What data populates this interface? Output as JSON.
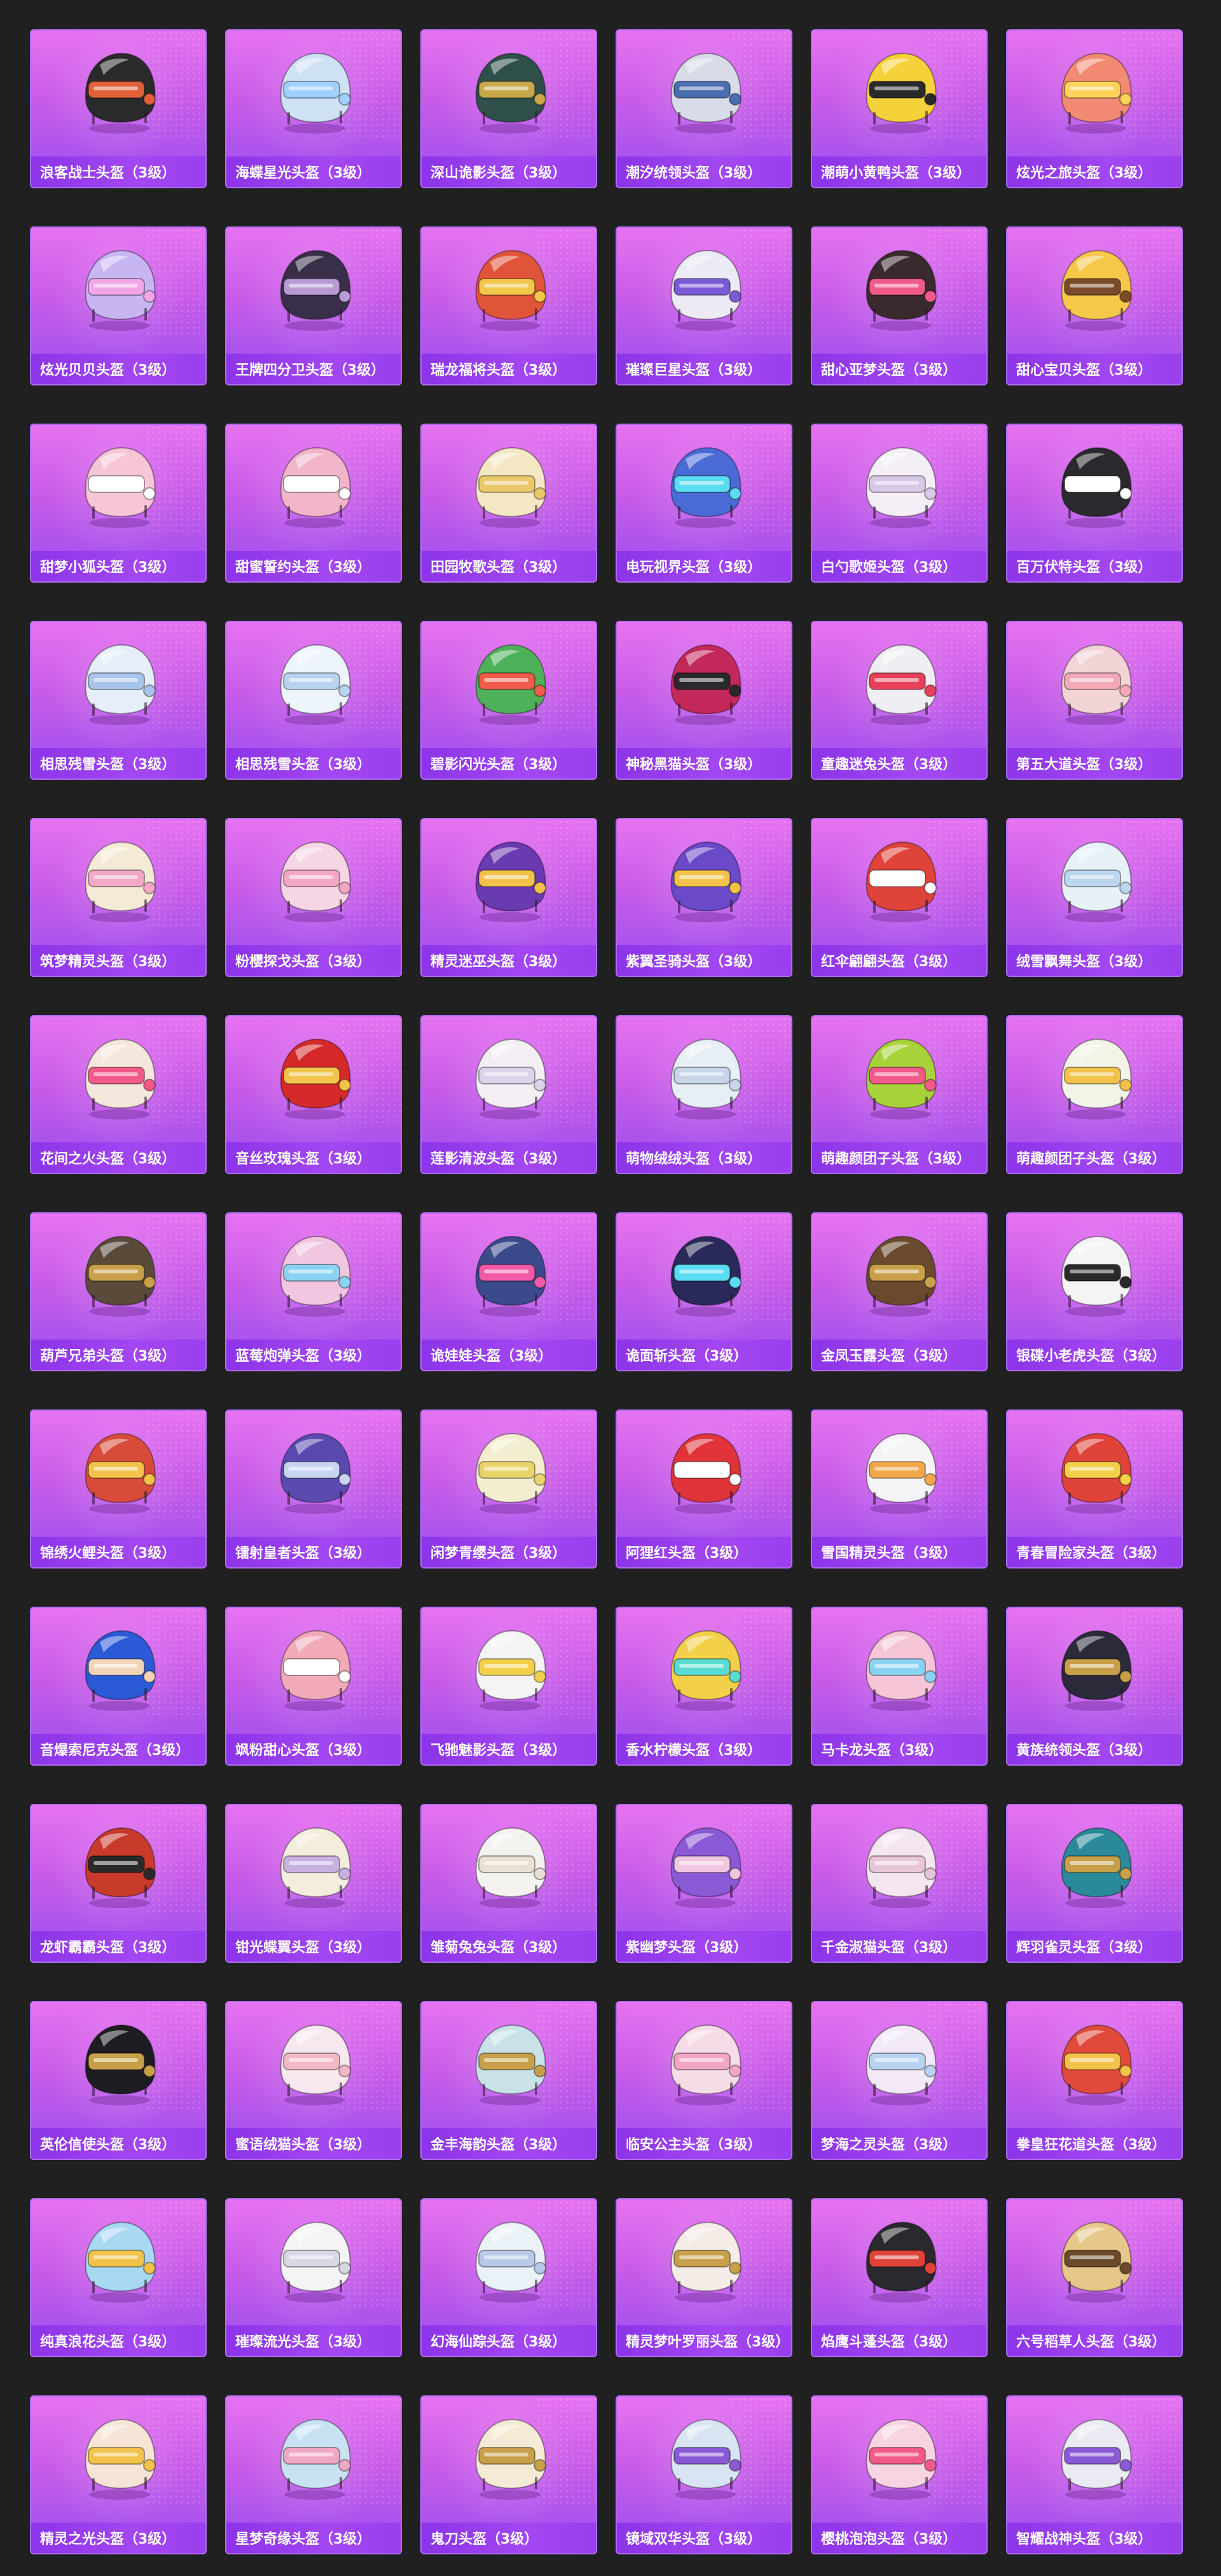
{
  "items": [
    {
      "name": "浪客战士头盔（3级）",
      "icon": "helmet-icon",
      "color": "#2a2a2a",
      "accent": "#e0603a"
    },
    {
      "name": "海蝶星光头盔（3级）",
      "icon": "helmet-icon",
      "color": "#cfe2f5",
      "accent": "#9fd0ff"
    },
    {
      "name": "深山诡影头盔（3级）",
      "icon": "helmet-icon",
      "color": "#2f4f4a",
      "accent": "#c8a84a"
    },
    {
      "name": "潮汐统领头盔（3级）",
      "icon": "helmet-icon",
      "color": "#d8dce8",
      "accent": "#4a6fb0"
    },
    {
      "name": "潮萌小黄鸭头盔（3级）",
      "icon": "helmet-icon",
      "color": "#f6d23a",
      "accent": "#2a2a2a"
    },
    {
      "name": "炫光之旅头盔（3级）",
      "icon": "helmet-icon",
      "color": "#f28a74",
      "accent": "#ffd35a"
    },
    {
      "name": "炫光贝贝头盔（3级）",
      "icon": "helmet-icon",
      "color": "#c8b6f2",
      "accent": "#f2a6e8"
    },
    {
      "name": "王牌四分卫头盔（3级）",
      "icon": "helmet-icon",
      "color": "#3a2f4a",
      "accent": "#b79ad6"
    },
    {
      "name": "瑞龙福将头盔（3级）",
      "icon": "helmet-icon",
      "color": "#e0553a",
      "accent": "#f2c74a"
    },
    {
      "name": "璀璨巨星头盔（3级）",
      "icon": "helmet-icon",
      "color": "#eceaf4",
      "accent": "#7a5ad6"
    },
    {
      "name": "甜心亚梦头盔（3级）",
      "icon": "helmet-icon",
      "color": "#3a2a2e",
      "accent": "#f25a8a"
    },
    {
      "name": "甜心宝贝头盔（3级）",
      "icon": "helmet-icon",
      "color": "#f6c84a",
      "accent": "#7a4a2a"
    },
    {
      "name": "甜梦小狐头盔（3级）",
      "icon": "helmet-icon",
      "color": "#f6c6d6",
      "accent": "#ffffff"
    },
    {
      "name": "甜蜜誓约头盔（3级）",
      "icon": "helmet-icon",
      "color": "#f2b4c8",
      "accent": "#ffffff"
    },
    {
      "name": "田园牧歌头盔（3级）",
      "icon": "helmet-icon",
      "color": "#f3e7c4",
      "accent": "#e8c86a"
    },
    {
      "name": "电玩视界头盔（3级）",
      "icon": "helmet-icon",
      "color": "#4a6ad6",
      "accent": "#5adcf2"
    },
    {
      "name": "白勺歌姬头盔（3级）",
      "icon": "helmet-icon",
      "color": "#f4eef6",
      "accent": "#d8c8e8"
    },
    {
      "name": "百万伏特头盔（3级）",
      "icon": "helmet-icon",
      "color": "#2a2a2e",
      "accent": "#ffffff"
    },
    {
      "name": "相思残雪头盔（3级）",
      "icon": "helmet-icon",
      "color": "#e6eef8",
      "accent": "#a8c4ea"
    },
    {
      "name": "相思残雪头盔（3级）",
      "icon": "helmet-icon",
      "color": "#eef4fb",
      "accent": "#b8d2f2"
    },
    {
      "name": "碧影闪光头盔（3级）",
      "icon": "helmet-icon",
      "color": "#4fb05a",
      "accent": "#f25a4a"
    },
    {
      "name": "神秘黑猫头盔（3级）",
      "icon": "helmet-icon",
      "color": "#c2285a",
      "accent": "#2a2a2e"
    },
    {
      "name": "童趣迷兔头盔（3级）",
      "icon": "helmet-icon",
      "color": "#f0eef2",
      "accent": "#e8405a"
    },
    {
      "name": "第五大道头盔（3级）",
      "icon": "helmet-icon",
      "color": "#f2d4d6",
      "accent": "#f2a8b8"
    },
    {
      "name": "筑梦精灵头盔（3级）",
      "icon": "helmet-icon",
      "color": "#f4ead6",
      "accent": "#f2a8c6"
    },
    {
      "name": "粉樱探戈头盔（3级）",
      "icon": "helmet-icon",
      "color": "#f6d6e4",
      "accent": "#f2a6c8"
    },
    {
      "name": "精灵迷巫头盔（3级）",
      "icon": "helmet-icon",
      "color": "#6a3ab0",
      "accent": "#f2c24a"
    },
    {
      "name": "紫翼圣骑头盔（3级）",
      "icon": "helmet-icon",
      "color": "#6a4ac8",
      "accent": "#f2c24a"
    },
    {
      "name": "红伞翩翩头盔（3级）",
      "icon": "helmet-icon",
      "color": "#e0433a",
      "accent": "#ffffff"
    },
    {
      "name": "绒雪飘舞头盔（3级）",
      "icon": "helmet-icon",
      "color": "#e8f0f8",
      "accent": "#bcd6ee"
    },
    {
      "name": "花间之火头盔（3级）",
      "icon": "helmet-icon",
      "color": "#f4e8dc",
      "accent": "#f25a8a"
    },
    {
      "name": "音丝玫瑰头盔（3级）",
      "icon": "helmet-icon",
      "color": "#d62a2a",
      "accent": "#f2c24a"
    },
    {
      "name": "莲影清波头盔（3级）",
      "icon": "helmet-icon",
      "color": "#f2eef4",
      "accent": "#dcd2ea"
    },
    {
      "name": "萌物绒绒头盔（3级）",
      "icon": "helmet-icon",
      "color": "#e8eef6",
      "accent": "#c8d4ea"
    },
    {
      "name": "萌趣颜团子头盔（3级）",
      "icon": "helmet-icon",
      "color": "#a8d23a",
      "accent": "#f25a8a"
    },
    {
      "name": "萌趣颜团子头盔（3级）",
      "icon": "helmet-icon",
      "color": "#f2f4e8",
      "accent": "#f2c24a"
    },
    {
      "name": "葫芦兄弟头盔（3级）",
      "icon": "helmet-icon",
      "color": "#5a4a3a",
      "accent": "#c8a04a"
    },
    {
      "name": "蓝莓炮弹头盔（3级）",
      "icon": "helmet-icon",
      "color": "#f2c6e0",
      "accent": "#8ad2f2"
    },
    {
      "name": "诡娃娃头盔（3级）",
      "icon": "helmet-icon",
      "color": "#3a4a8a",
      "accent": "#f25aa8"
    },
    {
      "name": "诡面斩头盔（3级）",
      "icon": "helmet-icon",
      "color": "#2a2a5a",
      "accent": "#5adcf2"
    },
    {
      "name": "金凤玉露头盔（3级）",
      "icon": "helmet-icon",
      "color": "#6a4a2e",
      "accent": "#c8a04a"
    },
    {
      "name": "银碟小老虎头盔（3级）",
      "icon": "helmet-icon",
      "color": "#f4f4f4",
      "accent": "#2a2a2a"
    },
    {
      "name": "锦绣火鲤头盔（3级）",
      "icon": "helmet-icon",
      "color": "#d84a3a",
      "accent": "#f2c24a"
    },
    {
      "name": "镭射皇者头盔（3级）",
      "icon": "helmet-icon",
      "color": "#5a4ab0",
      "accent": "#c8d4f2"
    },
    {
      "name": "闲梦青缨头盔（3级）",
      "icon": "helmet-icon",
      "color": "#f4eed0",
      "accent": "#e8d46a"
    },
    {
      "name": "阿狸红头盔（3级）",
      "icon": "helmet-icon",
      "color": "#e0333a",
      "accent": "#ffffff"
    },
    {
      "name": "雪国精灵头盔（3级）",
      "icon": "helmet-icon",
      "color": "#f4f4f6",
      "accent": "#f2a64a"
    },
    {
      "name": "青春冒险家头盔（3级）",
      "icon": "helmet-icon",
      "color": "#e0433a",
      "accent": "#f2d04a"
    },
    {
      "name": "音爆索尼克头盔（3级）",
      "icon": "helmet-icon",
      "color": "#2a5ad6",
      "accent": "#f2d4b8"
    },
    {
      "name": "飒粉甜心头盔（3级）",
      "icon": "helmet-icon",
      "color": "#f2aab8",
      "accent": "#ffffff"
    },
    {
      "name": "飞驰魅影头盔（3级）",
      "icon": "helmet-icon",
      "color": "#f4f4f4",
      "accent": "#f2d04a"
    },
    {
      "name": "香水柠檬头盔（3级）",
      "icon": "helmet-icon",
      "color": "#f2d04a",
      "accent": "#5adcd2"
    },
    {
      "name": "马卡龙头盔（3级）",
      "icon": "helmet-icon",
      "color": "#f6c6d8",
      "accent": "#8ad2f2"
    },
    {
      "name": "黄族统领头盔（3级）",
      "icon": "helmet-icon",
      "color": "#2a2a3a",
      "accent": "#c8a04a"
    },
    {
      "name": "龙虾霸霸头盔（3级）",
      "icon": "helmet-icon",
      "color": "#c83a2a",
      "accent": "#2a2a2a"
    },
    {
      "name": "钳光蝶翼头盔（3级）",
      "icon": "helmet-icon",
      "color": "#f4ecdc",
      "accent": "#c8b0e0"
    },
    {
      "name": "雏菊兔兔头盔（3级）",
      "icon": "helmet-icon",
      "color": "#f4f2ee",
      "accent": "#e8e0d4"
    },
    {
      "name": "紫幽梦头盔（3级）",
      "icon": "helmet-icon",
      "color": "#8a5ad6",
      "accent": "#f2c6e0"
    },
    {
      "name": "千金淑猫头盔（3级）",
      "icon": "helmet-icon",
      "color": "#f4e6ee",
      "accent": "#e8c6d8"
    },
    {
      "name": "辉羽雀灵头盔（3级）",
      "icon": "helmet-icon",
      "color": "#2a8a9a",
      "accent": "#c8a04a"
    },
    {
      "name": "英伦信使头盔（3级）",
      "icon": "helmet-icon",
      "color": "#1e1e22",
      "accent": "#c8a04a"
    },
    {
      "name": "蜜语绒猫头盔（3级）",
      "icon": "helmet-icon",
      "color": "#f6e8ee",
      "accent": "#f2b8c6"
    },
    {
      "name": "金丰海韵头盔（3级）",
      "icon": "helmet-icon",
      "color": "#c8e2e8",
      "accent": "#c8a04a"
    },
    {
      "name": "临安公主头盔（3级）",
      "icon": "helmet-icon",
      "color": "#f6dce6",
      "accent": "#f2a6c6"
    },
    {
      "name": "梦海之灵头盔（3级）",
      "icon": "helmet-icon",
      "color": "#f2e8f6",
      "accent": "#b8d2f2"
    },
    {
      "name": "拳皇狂花道头盔（3级）",
      "icon": "helmet-icon",
      "color": "#e04a3a",
      "accent": "#f2c24a"
    },
    {
      "name": "纯真浪花头盔（3级）",
      "icon": "helmet-icon",
      "color": "#a8d8f2",
      "accent": "#f2c24a"
    },
    {
      "name": "璀璨流光头盔（3级）",
      "icon": "helmet-icon",
      "color": "#f4f4f6",
      "accent": "#d8d8e4"
    },
    {
      "name": "幻海仙踪头盔（3级）",
      "icon": "helmet-icon",
      "color": "#eaf2f8",
      "accent": "#b8c8e8"
    },
    {
      "name": "精灵梦叶罗丽头盔（3级）",
      "icon": "helmet-icon",
      "color": "#f4ece6",
      "accent": "#c8a04a"
    },
    {
      "name": "焰鹰斗蓬头盔（3级）",
      "icon": "helmet-icon",
      "color": "#2a2a2e",
      "accent": "#e0433a"
    },
    {
      "name": "六号稻草人头盔（3级）",
      "icon": "helmet-icon",
      "color": "#e8c88a",
      "accent": "#6a4a2a"
    },
    {
      "name": "精灵之光头盔（3级）",
      "icon": "helmet-icon",
      "color": "#f6e4d6",
      "accent": "#f2c24a"
    },
    {
      "name": "星梦奇缘头盔（3级）",
      "icon": "helmet-icon",
      "color": "#c8e2f2",
      "accent": "#f2a6c6"
    },
    {
      "name": "鬼刀头盔（3级）",
      "icon": "helmet-icon",
      "color": "#f4ead6",
      "accent": "#c8a04a"
    },
    {
      "name": "镜域双华头盔（3级）",
      "icon": "helmet-icon",
      "color": "#d8e4f2",
      "accent": "#8a5ad6"
    },
    {
      "name": "樱桃泡泡头盔（3级）",
      "icon": "helmet-icon",
      "color": "#f6d4e2",
      "accent": "#f25a8a"
    },
    {
      "name": "智耀战神头盔（3级）",
      "icon": "helmet-icon",
      "color": "#eaeaf2",
      "accent": "#8a5ad6"
    }
  ]
}
